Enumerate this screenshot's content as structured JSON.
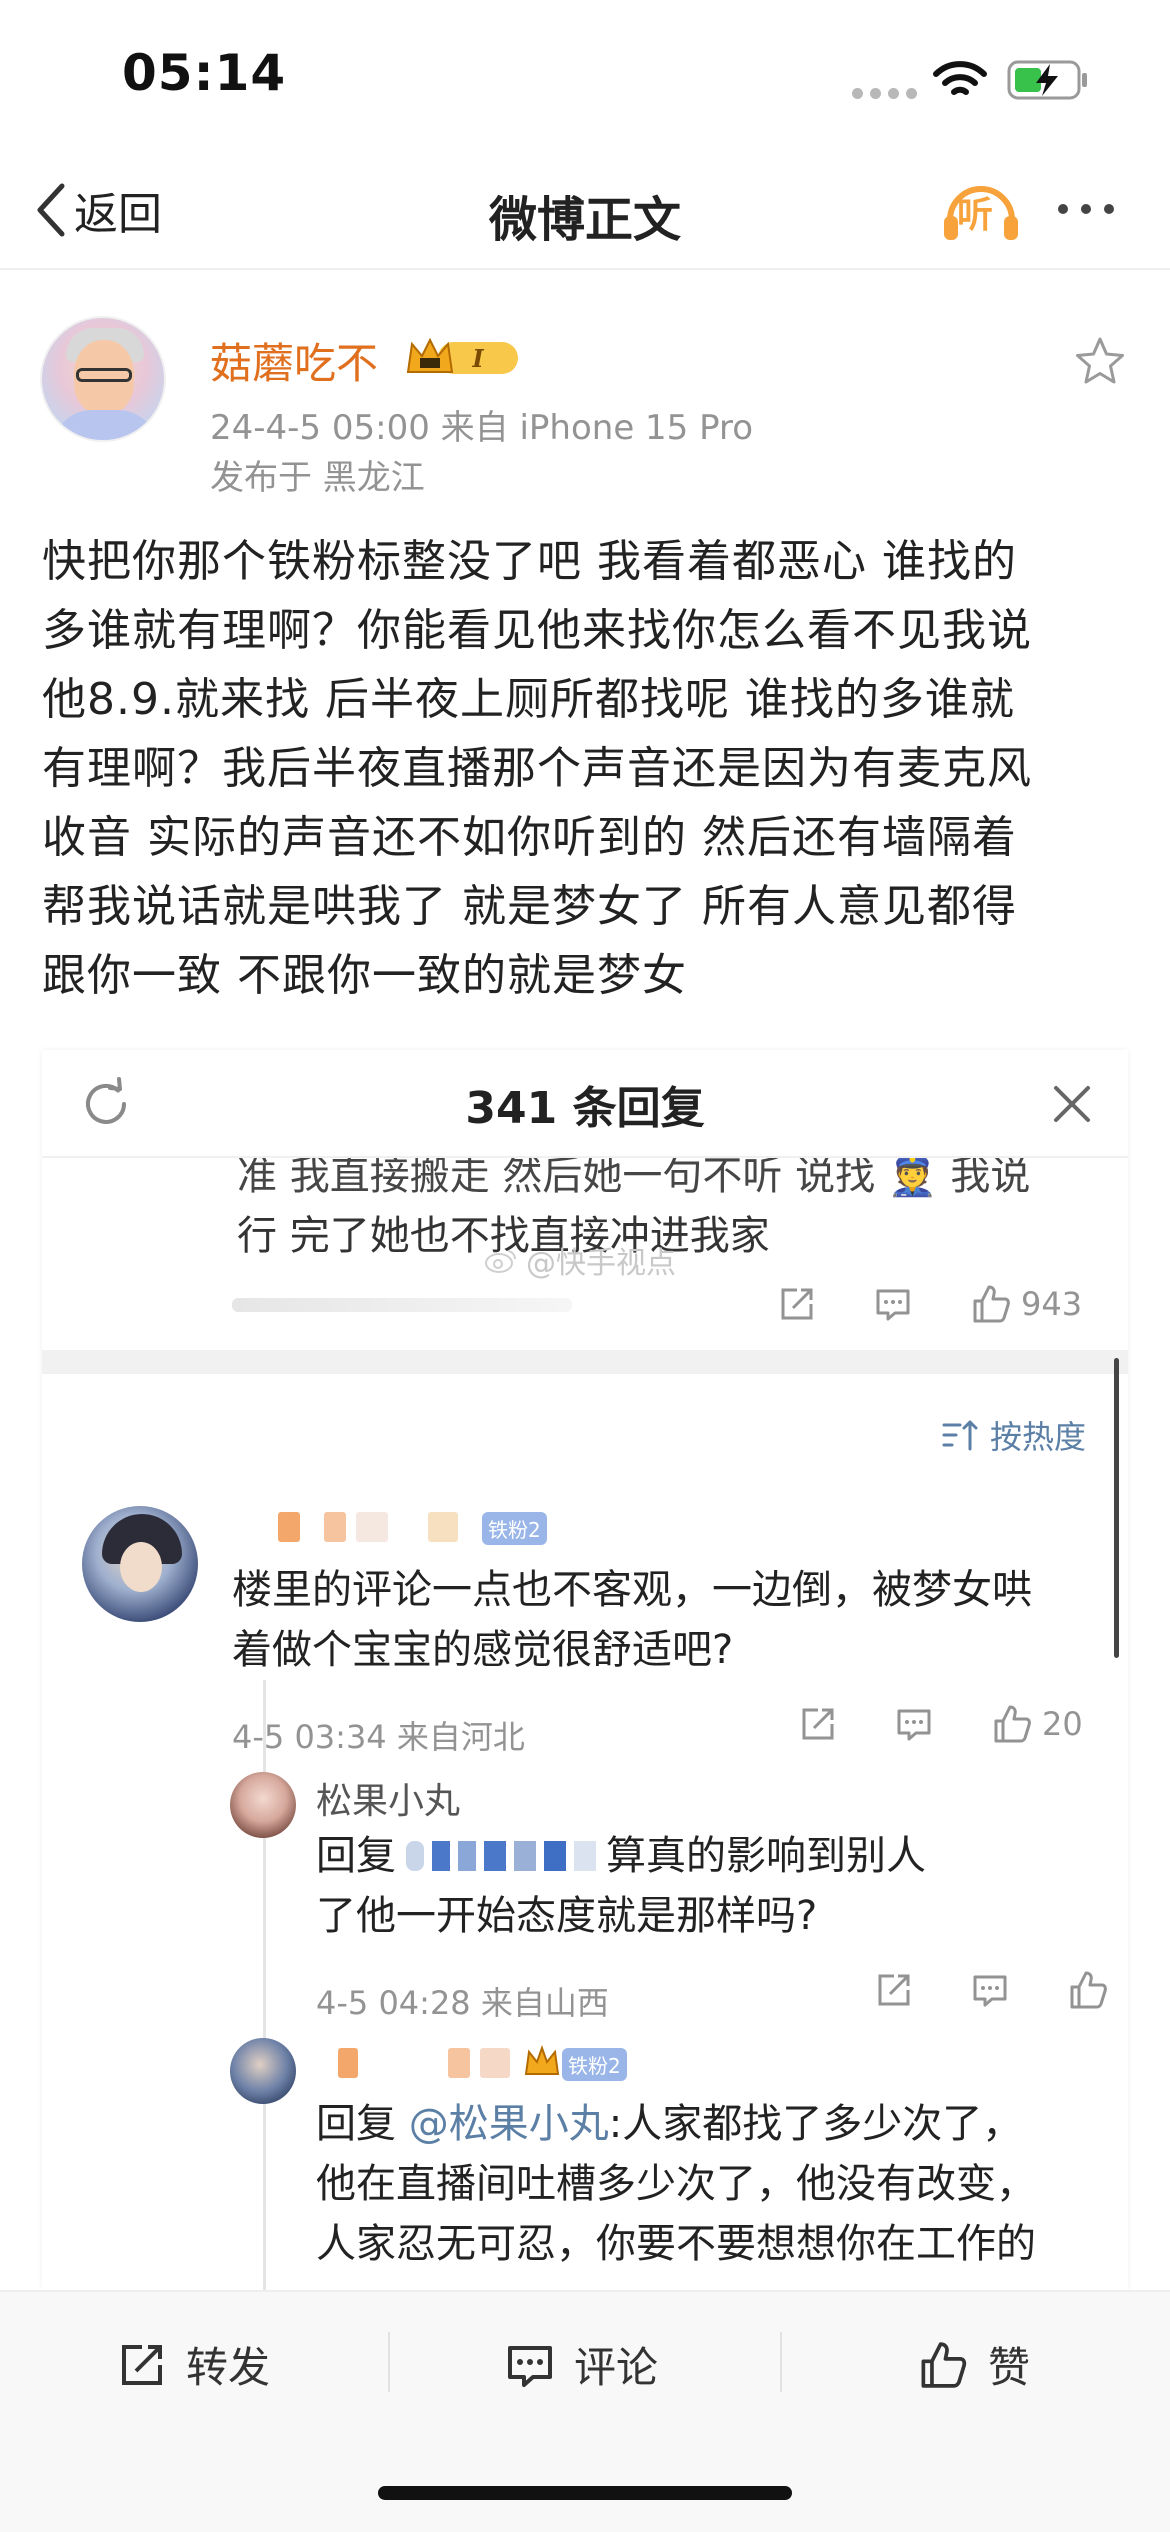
{
  "status_bar": {
    "time": "05:14"
  },
  "nav": {
    "back_label": "返回",
    "title": "微博正文",
    "listen_label": "听"
  },
  "post": {
    "author": "菇蘑吃不",
    "meta": "24-4-5 05:00  来自 iPhone 15 Pro",
    "location": "发布于 黑龙江",
    "body_lines": [
      "快把你那个铁粉标整没了吧 我看着都恶心 谁找的",
      "多谁就有理啊？你能看见他来找你怎么看不见我说",
      "他8.9.就来找 后半夜上厕所都找呢 谁找的多谁就",
      "有理啊？我后半夜直播那个声音还是因为有麦克风",
      "收音 实际的声音还不如你听到的 然后还有墙隔着",
      "帮我说话就是哄我了 就是梦女了 所有人意见都得",
      "跟你一致 不跟你一致的就是梦女"
    ]
  },
  "reply_panel": {
    "title": "341 条回复",
    "previous_reply": {
      "line1": "准 我直接搬走 然后她一句不听 说找 👮 我说",
      "line2": "行 完了她也不找直接冲进我家",
      "like_count": "943"
    },
    "watermark": "@快手视点",
    "sort_label": "按热度",
    "comments": [
      {
        "fan_badge": "铁粉2",
        "text_lines": [
          "楼里的评论一点也不客观，一边倒，被梦女哄",
          "着做个宝宝的感觉很舒适吧?"
        ],
        "meta": "4-5 03:34  来自河北",
        "like_count": "20"
      },
      {
        "author": "松果小丸",
        "reply_prefix": "回复",
        "text_line1_tail": "算真的影响到别人",
        "text_line2": "了他一开始态度就是那样吗?",
        "meta": "4-5 04:28  来自山西"
      },
      {
        "fan_badge": "铁粉2",
        "reply_prefix": "回复",
        "mention": "@松果小丸",
        "text_line1_tail": ":人家都找了多少次了，",
        "text_line2": "他在直播间吐槽多少次了，他没有改变，",
        "text_line3": "人家忍无可忍，你要不要想想你在工作的"
      }
    ]
  },
  "bottom_bar": {
    "repost_label": "转发",
    "comment_label": "评论",
    "like_label": "赞"
  },
  "colors": {
    "accent_orange": "#e06f1e",
    "link_blue": "#5c7fa6",
    "meta_gray": "#939393"
  }
}
